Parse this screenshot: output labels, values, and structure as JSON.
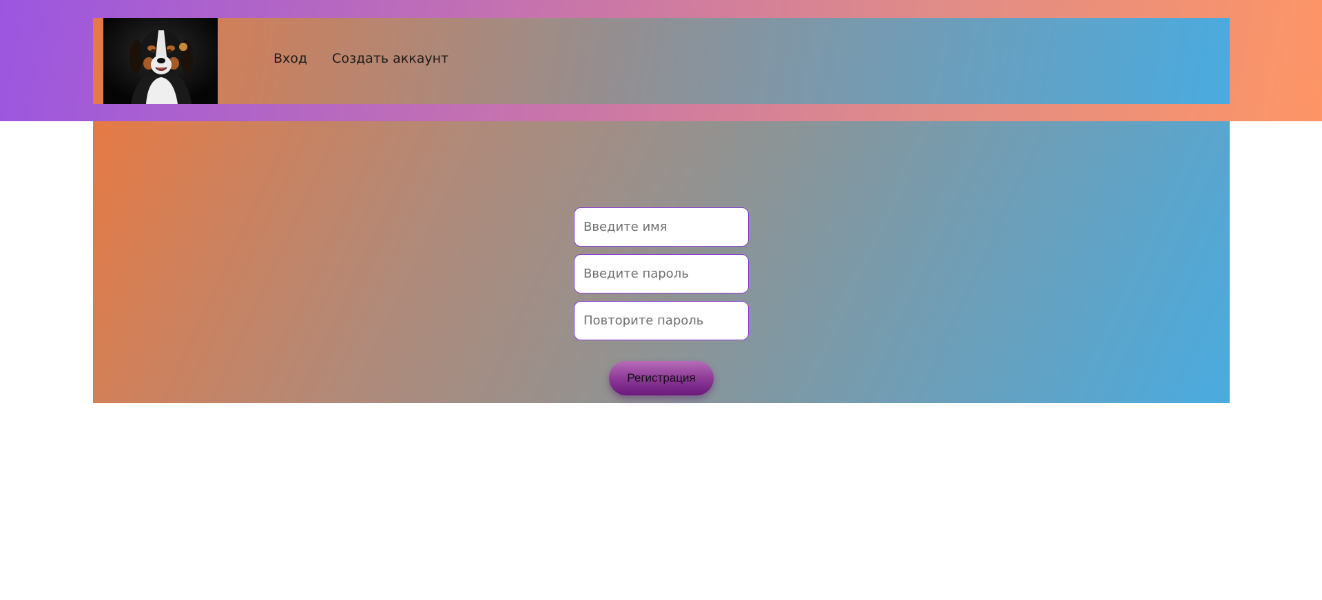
{
  "header": {
    "logo_alt": "dog",
    "nav": {
      "login": "Вход",
      "signup": "Создать аккаунт"
    }
  },
  "form": {
    "name_placeholder": "Введите имя",
    "password_placeholder": "Введите пароль",
    "repeat_password_placeholder": "Повторите пароль",
    "submit_label": "Регистрация"
  },
  "colors": {
    "accent": "#8a3fd8",
    "button": "#8b3796"
  }
}
